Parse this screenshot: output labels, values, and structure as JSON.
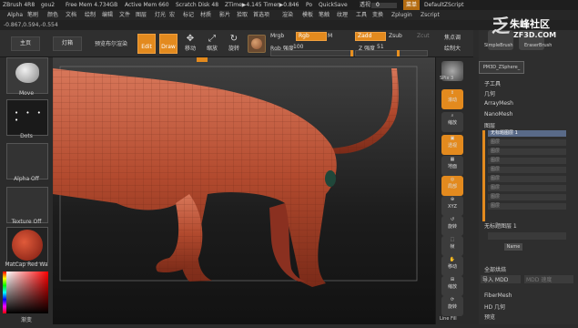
{
  "titlebar": {
    "app": "ZBrush 4R8",
    "doc": "gou2",
    "free_mem": "Free Mem 4.734GB",
    "active_mem": "Active Mem 660",
    "scratch": "Scratch Disk 48",
    "ztime": "ZTime▶4.145 Timer▶0.846",
    "po": "Po",
    "quicksave": "QuickSave",
    "transparency_label": "透视",
    "transparency_value": "0",
    "menus_label": "菜单",
    "script": "DefaultZScript"
  },
  "menu_items": [
    "Alpha",
    "笔刷",
    "颜色",
    "文档",
    "绘制",
    "编辑",
    "文件",
    "图层",
    "灯光",
    "宏",
    "标记",
    "材质",
    "影片",
    "拾取",
    "首选项",
    "渲染",
    "模板",
    "笔触",
    "纹理",
    "工具",
    "变换",
    "Zplugin",
    "Zscript"
  ],
  "coords": "-0.867,0.594,-0.554",
  "toolbar": {
    "home": "主页",
    "lightbox": "灯箱",
    "preview_render": "预览布尔渲染",
    "edit": "Edit",
    "draw": "Draw",
    "move": "移动",
    "scale": "缩放",
    "rotate": "旋转",
    "mrgb": "Mrgb",
    "rgb": "Rgb",
    "m": "M",
    "rgb_intensity_label": "Rgb 强度",
    "rgb_intensity_value": "100",
    "zadd": "Zadd",
    "zsub": "Zsub",
    "zcut": "Zcut",
    "z_intensity_label": "Z 强度",
    "z_intensity_value": "51",
    "focal_shift": "焦点调",
    "draw_size": "绘制大"
  },
  "left_panel": {
    "move_label": "Move",
    "dots_label": "Dots",
    "alpha_off": "Alpha Off",
    "texture_off": "Texture Off",
    "matcap": "MatCap Red Wa",
    "gradient": "渐变"
  },
  "right_strip": [
    "SPix 3",
    "滚动",
    "缩放",
    "透视",
    "地面",
    "局部",
    "XYZ",
    "旋转",
    "帧",
    "移动",
    "缩放",
    "旋转",
    "Line Fill"
  ],
  "right_panel": {
    "simple_brush": "SimpleBrush",
    "eraser_brush": "EraserBrush",
    "pm3d": "PM3D_ZSphere_",
    "subtool": "子工具",
    "geometry": "几何",
    "arraymesh": "ArrayMesh",
    "nanomesh": "NanoMesh",
    "layers": "图层",
    "layer1": "无标题图层 1",
    "layer1_bottom": "无标题图层 1",
    "layer_rows": [
      "图层",
      "图层",
      "图层",
      "图层",
      "图层",
      "图层",
      "图层",
      "图层"
    ],
    "name_btn": "Name",
    "bake_all": "全部烘焙",
    "import_mdd": "导入 MDD",
    "mdd_speed": "MDD 速度",
    "fibermesh": "FiberMesh",
    "hd_geometry": "HD 几何",
    "preview": "预览"
  },
  "watermark": {
    "line1": "朱峰社区",
    "line2": "ZF3D.COM"
  },
  "colors": {
    "accent": "#e38a1e",
    "model": "#b24a2e",
    "layer_active": "#596a88"
  }
}
